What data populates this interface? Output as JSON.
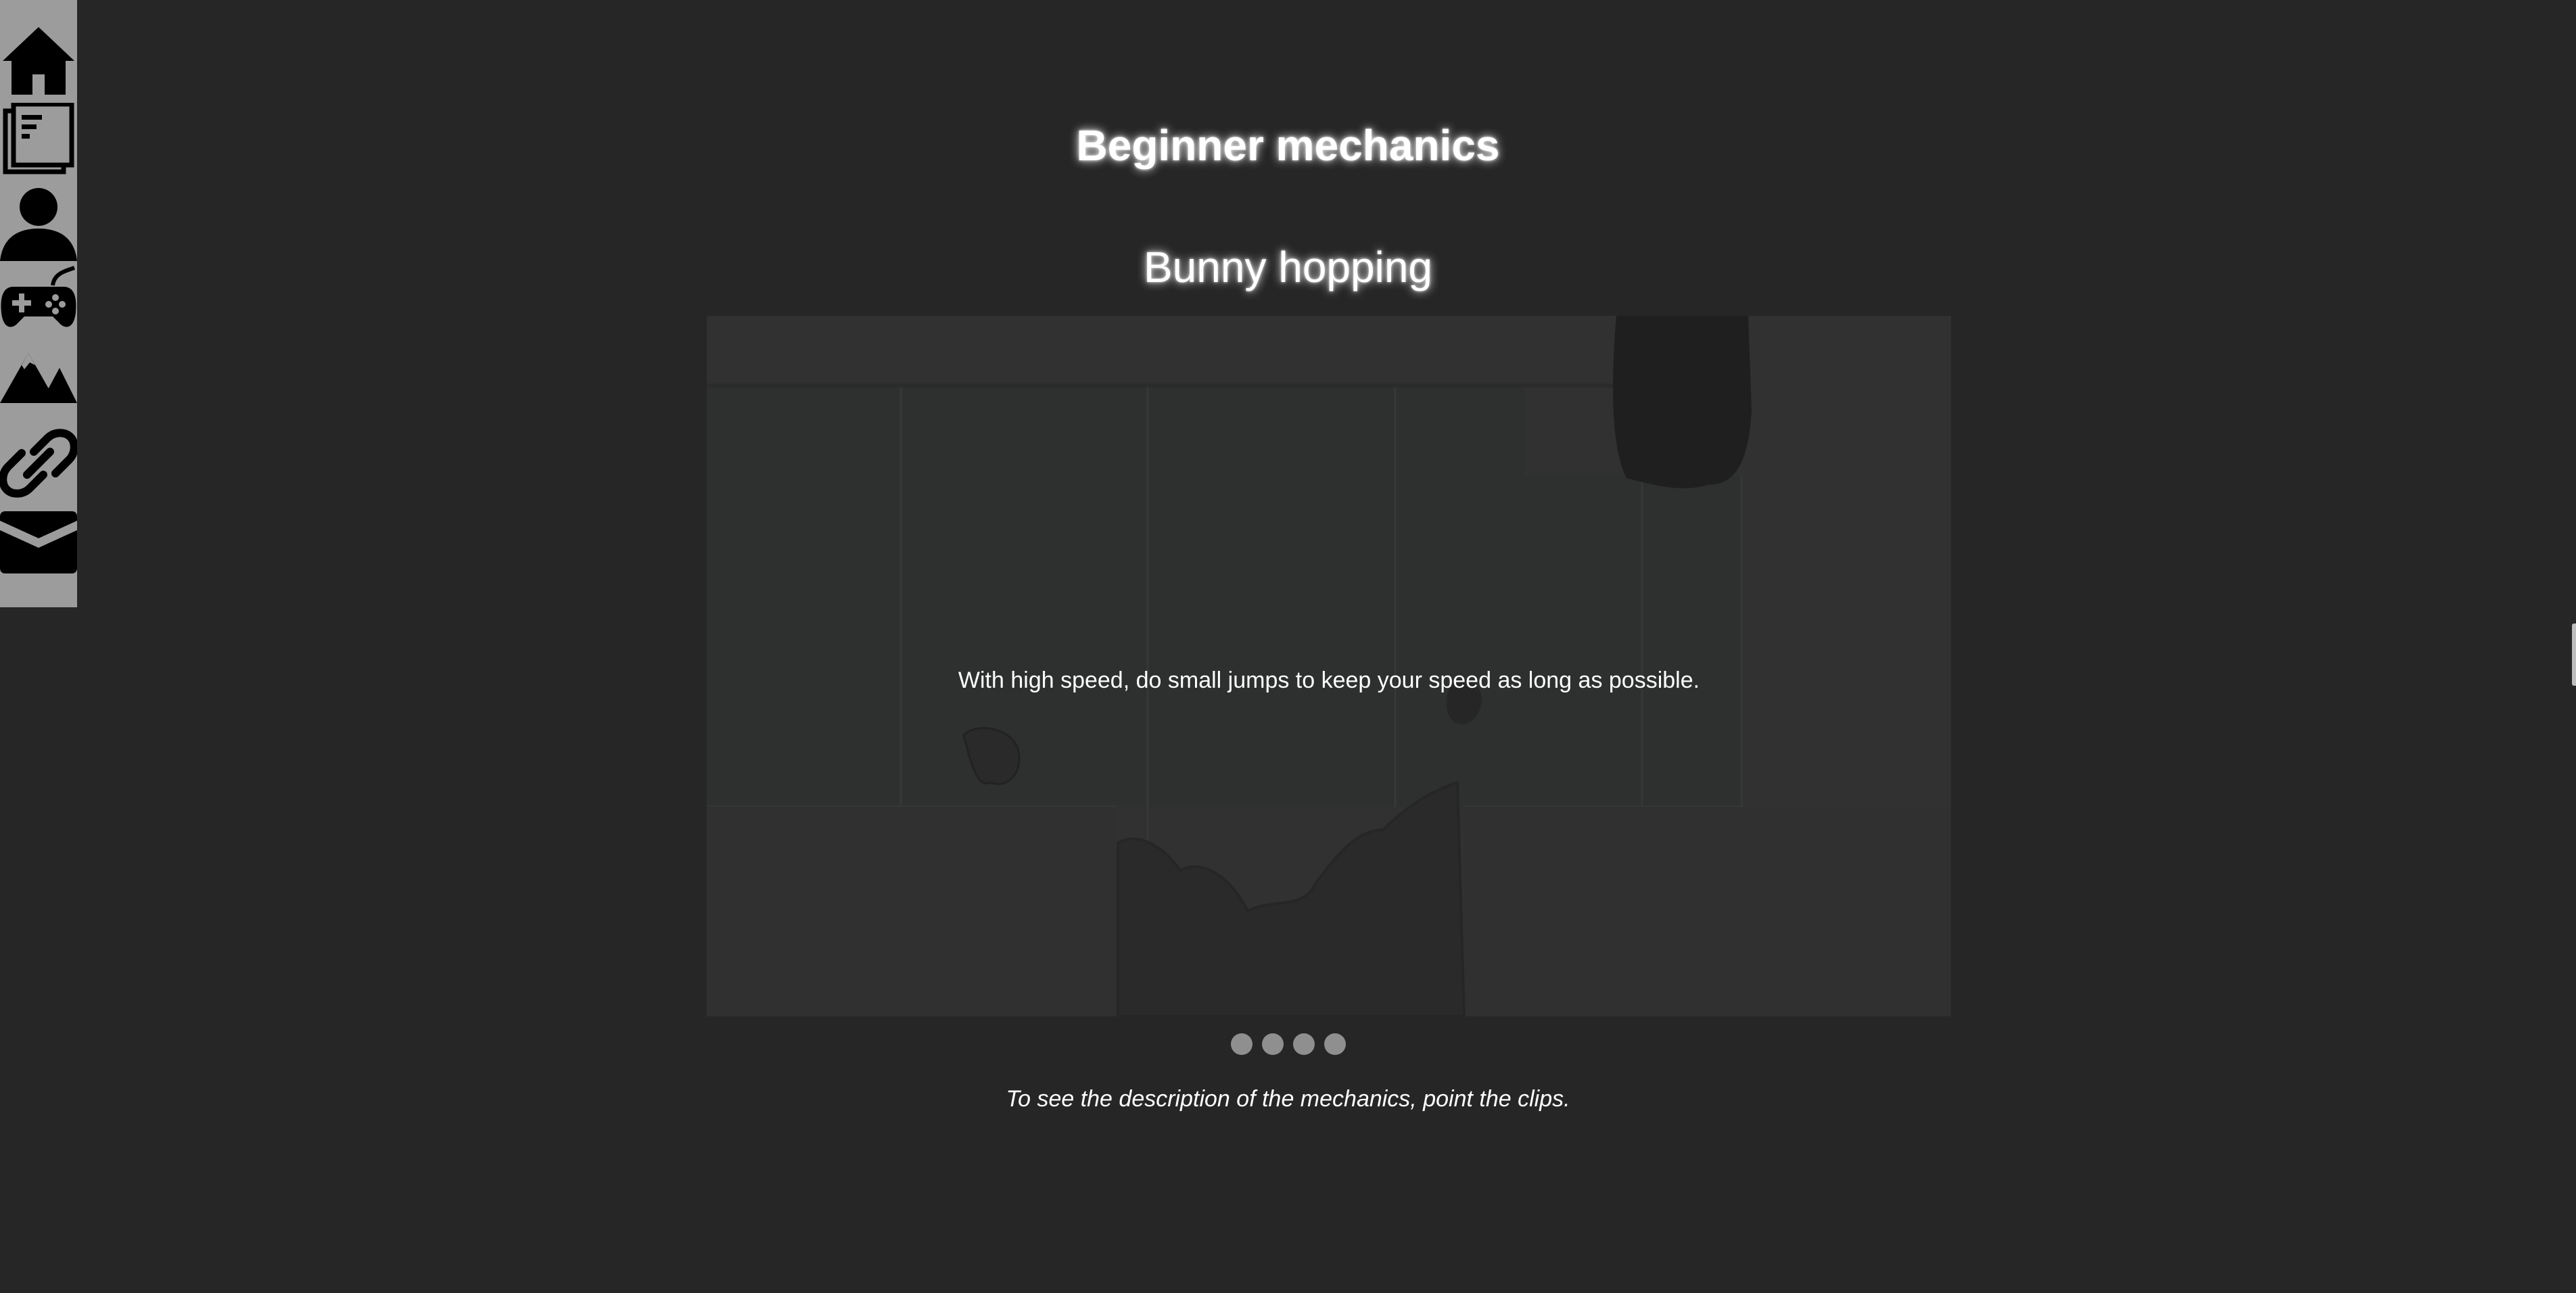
{
  "sidebar": {
    "items": [
      {
        "icon": "home-icon"
      },
      {
        "icon": "news-icon"
      },
      {
        "icon": "user-icon"
      },
      {
        "icon": "gamepad-icon"
      },
      {
        "icon": "mountains-icon"
      },
      {
        "icon": "link-icon"
      },
      {
        "icon": "mail-icon"
      }
    ]
  },
  "main": {
    "title": "Beginner mechanics",
    "section_title": "Bunny hopping",
    "clip_caption": "With high speed, do small jumps to keep your speed as long as possible.",
    "carousel": {
      "dot_count": 4,
      "active_index": 0
    },
    "hint": "To see the description of the mechanics, point the clips."
  },
  "colors": {
    "background": "#262626",
    "sidebar": "#9c9c9c",
    "clip_background": "#2f2f2f",
    "dot": "#8f8f8f",
    "text": "#ffffff"
  }
}
